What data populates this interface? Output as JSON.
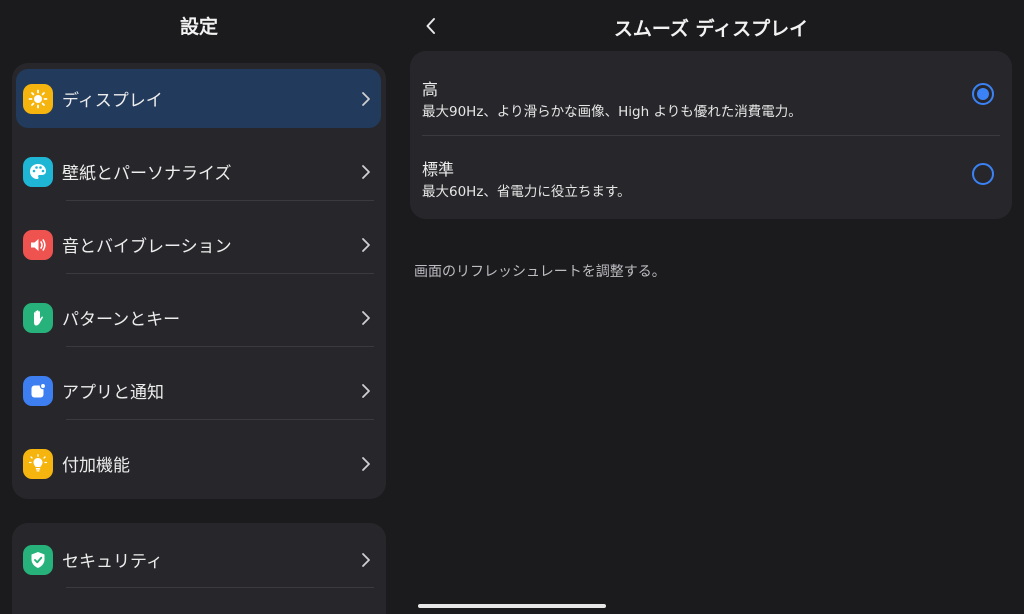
{
  "left": {
    "title": "設定",
    "items": [
      {
        "label": "ディスプレイ",
        "icon": "brightness-icon",
        "color": "#f6b40e",
        "active": true
      },
      {
        "label": "壁紙とパーソナライズ",
        "icon": "palette-icon",
        "color": "#1fb6d6"
      },
      {
        "label": "音とバイブレーション",
        "icon": "speaker-icon",
        "color": "#ef5350"
      },
      {
        "label": "パターンとキー",
        "icon": "hand-icon",
        "color": "#26b27a"
      },
      {
        "label": "アプリと通知",
        "icon": "app-notification-icon",
        "color": "#3d7ef0"
      },
      {
        "label": "付加機能",
        "icon": "lightbulb-icon",
        "color": "#f6b40e"
      }
    ],
    "items2": [
      {
        "label": "セキュリティ",
        "icon": "shield-check-icon",
        "color": "#26b27a"
      }
    ]
  },
  "right": {
    "title": "スムーズ ディスプレイ",
    "back_icon": "chevron-left-icon",
    "options": [
      {
        "title": "高",
        "desc": "最大90Hz、より滑らかな画像、High よりも優れた消費電力。",
        "selected": true
      },
      {
        "title": "標準",
        "desc": "最大60Hz、省電力に役立ちます。",
        "selected": false
      }
    ],
    "footnote": "画面のリフレッシュレートを調整する。"
  },
  "colors": {
    "accent": "#3b82f6",
    "active_row": "#223a5b",
    "card": "#27272b",
    "background": "#1b1b1d"
  }
}
